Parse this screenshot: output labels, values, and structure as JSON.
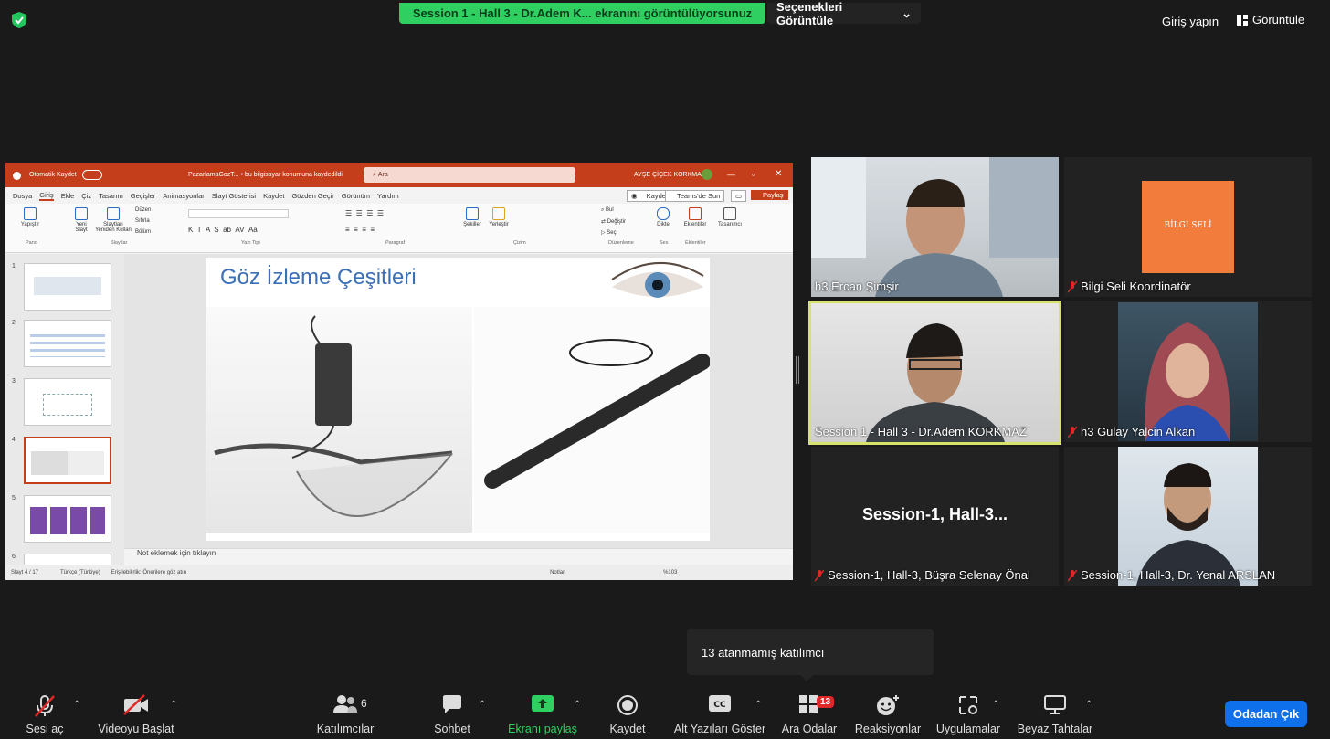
{
  "top": {
    "share_banner": "Session 1 - Hall 3 - Dr.Adem K... ekranını görüntülüyorsunuz",
    "view_options": "Seçenekleri Görüntüle",
    "signin": "Giriş yapın",
    "view": "Görüntüle"
  },
  "shared": {
    "autosave": "Otomatik Kaydet",
    "filename": "PazarlamaGozT... • bu bilgisayar konumuna kaydedildi",
    "search": "Ara",
    "user": "AYŞE ÇİÇEK KORKMAZ",
    "tabs": [
      "Dosya",
      "Giriş",
      "Ekle",
      "Çiz",
      "Tasarım",
      "Geçişler",
      "Animasyonlar",
      "Slayt Gösterisi",
      "Kaydet",
      "Gözden Geçir",
      "Görünüm",
      "Yardım"
    ],
    "record": "Kaydet",
    "teams": "Teams'de Sun",
    "share": "Paylaş",
    "ribbon_groups": [
      "Pano",
      "Slaytlar",
      "Yazı Tipi",
      "Paragraf",
      "Çizim",
      "Düzenleme",
      "Ses",
      "Eklentiler"
    ],
    "ribbon_buttons": [
      "Yapıştır",
      "Yeni Slayt",
      "Slaytları Yeniden Kullan",
      "Düzen",
      "Sıfırla",
      "Bölüm",
      "Şekiller",
      "Yerleştir",
      "Bul",
      "Değiştir",
      "Seç",
      "Dikte",
      "Eklentiler",
      "Tasarımcı"
    ],
    "slide_numbers": [
      "1",
      "2",
      "3",
      "4",
      "5",
      "6"
    ],
    "slide_title": "Göz İzleme Çeşitleri",
    "notes": "Not eklemek için tıklayın",
    "status_left": "Slayt 4 / 17",
    "status_lang": "Türkçe (Türkiye)",
    "status_access": "Erişilebilirlik: Önerilere göz atın",
    "status_notes": "Notlar",
    "zoom": "%103"
  },
  "tiles": [
    {
      "name": "h3 Ercan Şimşir",
      "muted": false
    },
    {
      "name": "Bilgi Seli Koordinatör",
      "muted": true
    },
    {
      "name": "Session 1 - Hall 3 - Dr.Adem KORKMAZ",
      "muted": false
    },
    {
      "name": "h3 Gulay Yalcin Alkan",
      "muted": true
    },
    {
      "name": "Session-1, Hall-3, Büşra Selenay Önal",
      "muted": true,
      "center_text": "Session-1,  Hall-3..."
    },
    {
      "name": "Session-1, Hall-3, Dr. Yenal ARSLAN",
      "muted": true
    }
  ],
  "logo_text": "BİLGİ SELİ",
  "tooltip": "13 atanmamış katılımcı",
  "toolbar": {
    "mute": "Sesi aç",
    "video": "Videoyu Başlat",
    "participants": "Katılımcılar",
    "participants_count": "6",
    "chat": "Sohbet",
    "share": "Ekranı paylaş",
    "record": "Kaydet",
    "captions": "Alt Yazıları Göster",
    "breakout": "Ara Odalar",
    "breakout_badge": "13",
    "reactions": "Reaksiyonlar",
    "apps": "Uygulamalar",
    "whiteboard": "Beyaz Tahtalar",
    "leave": "Odadan Çık"
  },
  "colors": {
    "banner": "#2fd061",
    "ppt_red": "#c43e1c",
    "leave_blue": "#0e71eb",
    "active_speaker": "#d7e36b",
    "mute_red": "#e02828"
  }
}
